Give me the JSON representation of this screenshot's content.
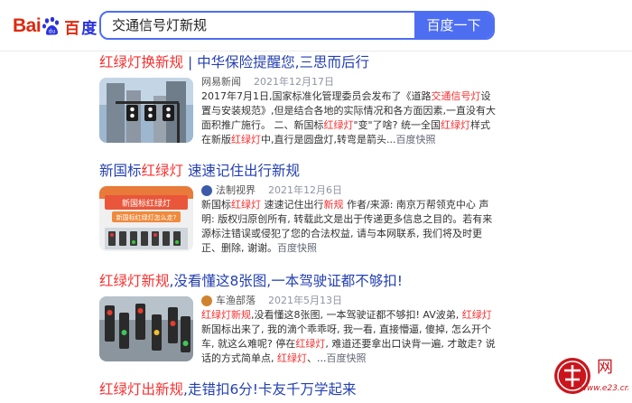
{
  "header": {
    "logo_bai": "Bai",
    "logo_du": "du",
    "logo_cn_a": "百",
    "logo_cn_b": "度",
    "search_value": "交通信号灯新规",
    "search_button": "百度一下"
  },
  "results": [
    {
      "title_hl": "红绿灯换新规",
      "title_rest": " | 中华保险提醒您,三思而后行",
      "source": "网易新闻",
      "date": "2021年12月17日",
      "abs_1": "2017年7月1日,国家标准化管理委员会发布了《道路",
      "abs_hl1": "交通信号灯",
      "abs_2": "设置与安装规范》,但是结合各地的实际情况和各方面因素,一直没有大面积推广施行。 二、新国标",
      "abs_hl2": "红绿灯",
      "abs_3": "\"变\"了啥? 统一全国",
      "abs_hl3": "红绿灯",
      "abs_4": "样式 在新版",
      "abs_hl4": "红绿灯",
      "abs_5": "中,直行是圆盘灯,转弯是箭头...",
      "snapshot": "百度快照"
    },
    {
      "title_a": "新国标",
      "title_hl": "红绿灯",
      "title_rest": " 速速记住出行新规",
      "source": "法制视界",
      "date": "2021年12月6日",
      "thumb_text_1": "新国标红绿灯",
      "thumb_text_2": "新国标红绿灯怎么走?",
      "abs_1": "新国标",
      "abs_hl1": "红绿灯",
      "abs_2": " 速速记住出行",
      "abs_hl2": "新规",
      "abs_3": " 作者/来源: 南京万帮领克中心 声明: 版权归原创所有, 转载此文是出于传递更多信息之目的。若有来源标注错误或侵犯了您的合法权益, 请与本网联系, 我们将及时更正、删除, 谢谢。",
      "snapshot": "百度快照"
    },
    {
      "title_hl": "红绿灯新规",
      "title_rest": ",没看懂这8张图,一本驾驶证都不够扣!",
      "source": "车渔部落",
      "date": "2021年5月13日",
      "abs_hl1": "红绿灯新规",
      "abs_1": ",没看懂这8张图, 一本驾驶证都不够扣! AV波弟, ",
      "abs_hl2": "红绿灯",
      "abs_2": "新国标出来了, 我的滴个乖乖呀, 我一看, 直接懵逼, 傻掉, 怎么开个车, 就这么难呢? 停在",
      "abs_hl3": "红绿灯",
      "abs_3": ", 难道还要拿出口诀背一遍, 才敢走? 说话的方式简单点, ",
      "abs_hl4": "红绿灯",
      "abs_4": "、...",
      "snapshot": "百度快照"
    },
    {
      "title_hl": "红绿灯出新规",
      "title_rest": ",走错扣6分!卡友千万学起来"
    }
  ],
  "watermark": {
    "text": "网",
    "url": "www.e23.cn"
  },
  "colors": {
    "accent": "#4e6ef2",
    "title": "#2440b3",
    "highlight": "#f73131",
    "logo_red": "#de2910",
    "logo_blue": "#2932e1"
  }
}
